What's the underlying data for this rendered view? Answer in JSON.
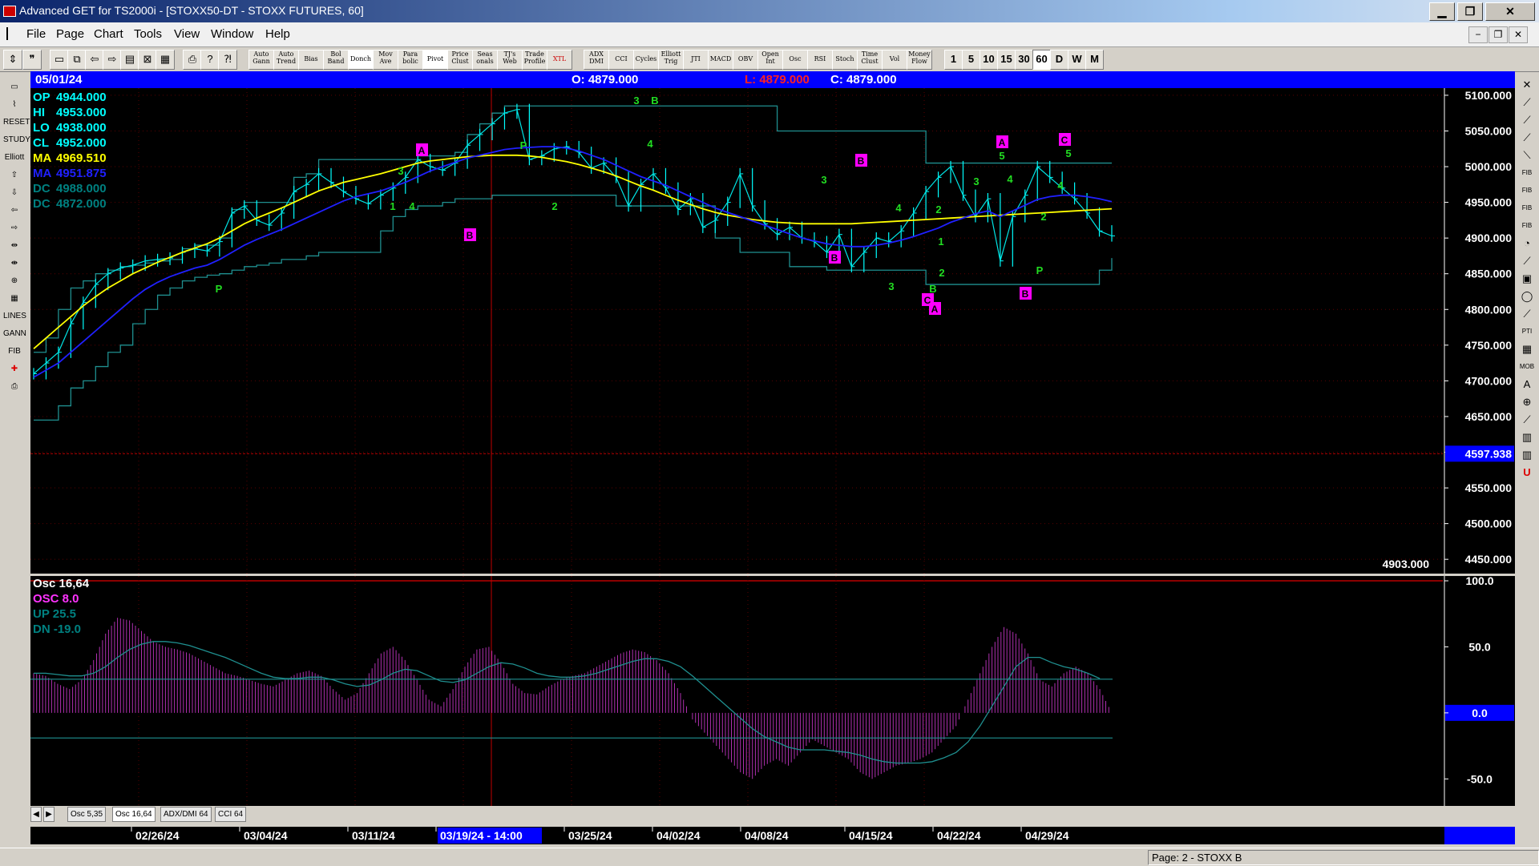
{
  "window": {
    "title": "Advanced GET for TS2000i - [STOXX50-DT - STOXX FUTURES, 60]",
    "minimize": "▁",
    "maximize": "❐",
    "close": "✕"
  },
  "menu": [
    "File",
    "Page",
    "Chart",
    "Tools",
    "View",
    "Window",
    "Help"
  ],
  "mdi_controls": [
    "−",
    "❐",
    "✕"
  ],
  "toolbar": {
    "studies": [
      "Auto Gann",
      "Auto Trend",
      "Bias",
      "Bol Band",
      "Donch",
      "Mov Ave",
      "Para bolic",
      "Pivot",
      "Price Clust",
      "Seas onals",
      "TJ's Web",
      "Trade Profile",
      "XTL",
      "ADX DMI",
      "CCI",
      "Cycles",
      "Elliott Trig",
      "JTI",
      "MACD",
      "OBV",
      "Open Int",
      "Osc",
      "RSI",
      "Stoch",
      "Time Clust",
      "Vol",
      "Money Flow"
    ],
    "periods": [
      "1",
      "5",
      "10",
      "15",
      "30",
      "60",
      "D",
      "W",
      "M"
    ],
    "active_period": "60"
  },
  "left_tools": [
    "open-icon",
    "gann-icon",
    "reset-icon",
    "study-icon",
    "elliott-icon",
    "arrow-up-icon",
    "arrow-down-icon",
    "arrow-left-icon",
    "arrow-right-icon",
    "expand-icon",
    "compress-icon",
    "zoom-icon",
    "grid-icon",
    "lines-icon",
    "gann-box-icon",
    "fib-icon",
    "cross-icon",
    "printer-icon"
  ],
  "left_tool_labels": [
    "",
    "",
    "RESET",
    "STUDY",
    "Elliott",
    "",
    "",
    "",
    "",
    "",
    "",
    "",
    "",
    "LINES",
    "GANN",
    "FIB",
    "",
    ""
  ],
  "right_tools": [
    "FIB",
    "FIB RET",
    "FIB EXT",
    "FIB TIME",
    "PTI",
    "MOB",
    "A"
  ],
  "infobar": {
    "date": "05/01/24",
    "open": "O: 4879.000",
    "low": "L: 4879.000",
    "close": "C: 4879.000"
  },
  "price_legend": [
    {
      "label": "OP",
      "value": "4944.000",
      "color": "#00ffff"
    },
    {
      "label": "HI",
      "value": "4953.000",
      "color": "#00ffff"
    },
    {
      "label": "LO",
      "value": "4938.000",
      "color": "#00ffff"
    },
    {
      "label": "CL",
      "value": "4952.000",
      "color": "#00ffff"
    },
    {
      "label": "MA",
      "value": "4969.510",
      "color": "#ffff00"
    },
    {
      "label": "MA",
      "value": "4951.875",
      "color": "#2020ff"
    },
    {
      "label": "DC",
      "value": "4988.000",
      "color": "#008080"
    },
    {
      "label": "DC",
      "value": "4872.000",
      "color": "#008080"
    }
  ],
  "price_axis": [
    "5100.000",
    "5050.000",
    "5000.000",
    "4950.000",
    "4900.000",
    "4850.000",
    "4800.000",
    "4750.000",
    "4700.000",
    "4650.000",
    "4600.000",
    "4550.000",
    "4500.000",
    "4450.000"
  ],
  "price_marker": "4597.938",
  "last_price": "4903.000",
  "osc_legend": [
    {
      "label": "Osc 16,64",
      "color": "#ffffff"
    },
    {
      "label": "OSC 8.0",
      "color": "#ff33ff"
    },
    {
      "label": "UP   25.5",
      "color": "#008080"
    },
    {
      "label": "DN   -19.0",
      "color": "#008080"
    }
  ],
  "osc_axis": [
    "100.0",
    "50.0",
    "0.0",
    "-50.0"
  ],
  "tabs": [
    "Osc 5,35",
    "Osc 16,64",
    "ADX/DMI 64",
    "CCI 64"
  ],
  "active_tab": "Osc 16,64",
  "date_axis": [
    "02/26/24",
    "03/04/24",
    "03/11/24",
    "03/19/24 - 14:00",
    "03/25/24",
    "04/02/24",
    "04/08/24",
    "04/15/24",
    "04/22/24",
    "04/29/24"
  ],
  "status": "Page: 2 - STOXX B",
  "elliott_labels": {
    "magenta_boxes": [
      "A",
      "B",
      "B",
      "B",
      "A",
      "C",
      "A",
      "C",
      "B"
    ],
    "green": [
      "3",
      "B",
      "4",
      "P",
      "3",
      "1",
      "4",
      "2",
      "3",
      "2",
      "4",
      "3",
      "1",
      "2",
      "3",
      "5",
      "4",
      "5",
      "4",
      "2",
      "P",
      "P",
      "B"
    ]
  },
  "chart_data": {
    "type": "line",
    "title": "",
    "ylim": [
      4430,
      5110
    ],
    "price_close": [
      4710,
      4725,
      4740,
      4780,
      4810,
      4835,
      4850,
      4858,
      4862,
      4868,
      4870,
      4872,
      4880,
      4885,
      4882,
      4895,
      4935,
      4945,
      4925,
      4918,
      4935,
      4965,
      4975,
      4990,
      4978,
      4965,
      4955,
      4948,
      4960,
      4970,
      4985,
      5010,
      5000,
      4995,
      5005,
      5030,
      5045,
      5060,
      5075,
      5080,
      5010,
      5015,
      5025,
      5028,
      5020,
      4998,
      5005,
      4985,
      4945,
      4975,
      4990,
      4970,
      4940,
      4955,
      4915,
      4925,
      4950,
      4990,
      4945,
      4920,
      4905,
      4915,
      4900,
      4895,
      4880,
      4905,
      4860,
      4880,
      4900,
      4895,
      4910,
      4935,
      4965,
      4985,
      5000,
      4960,
      4930,
      4955,
      4868,
      4930,
      4960,
      5000,
      4985,
      4970,
      4955,
      4935,
      4910,
      4903
    ],
    "ma_yellow": [
      4745,
      4760,
      4775,
      4790,
      4805,
      4818,
      4830,
      4840,
      4850,
      4858,
      4866,
      4873,
      4880,
      4886,
      4892,
      4900,
      4910,
      4920,
      4928,
      4935,
      4942,
      4950,
      4958,
      4966,
      4972,
      4978,
      4982,
      4986,
      4990,
      4995,
      5000,
      5005,
      5008,
      5010,
      5012,
      5014,
      5015,
      5016,
      5016,
      5016,
      5015,
      5013,
      5010,
      5007,
      5003,
      4998,
      4993,
      4987,
      4980,
      4973,
      4967,
      4960,
      4953,
      4947,
      4941,
      4936,
      4932,
      4929,
      4926,
      4924,
      4922,
      4921,
      4920,
      4920,
      4920,
      4920,
      4920,
      4921,
      4922,
      4923,
      4924,
      4925,
      4926,
      4927,
      4928,
      4929,
      4930,
      4931,
      4932,
      4933,
      4934,
      4935,
      4936,
      4937,
      4938,
      4939,
      4940,
      4941
    ],
    "ma_blue": [
      4705,
      4715,
      4725,
      4740,
      4755,
      4770,
      4785,
      4800,
      4815,
      4828,
      4838,
      4846,
      4852,
      4858,
      4862,
      4870,
      4880,
      4890,
      4898,
      4905,
      4912,
      4920,
      4928,
      4936,
      4944,
      4952,
      4958,
      4962,
      4966,
      4972,
      4978,
      4986,
      4994,
      5000,
      5006,
      5012,
      5016,
      5020,
      5024,
      5026,
      5027,
      5028,
      5028,
      5026,
      5022,
      5016,
      5010,
      5002,
      4994,
      4986,
      4980,
      4974,
      4966,
      4958,
      4950,
      4942,
      4936,
      4930,
      4924,
      4918,
      4912,
      4906,
      4900,
      4896,
      4892,
      4890,
      4888,
      4888,
      4890,
      4893,
      4897,
      4902,
      4908,
      4914,
      4922,
      4928,
      4934,
      4938,
      4930,
      4938,
      4946,
      4954,
      4958,
      4960,
      4960,
      4958,
      4955,
      4951
    ],
    "dc_upper": [
      4740,
      4760,
      4800,
      4830,
      4840,
      4850,
      4855,
      4860,
      4862,
      4865,
      4868,
      4870,
      4885,
      4890,
      4890,
      4900,
      4940,
      4950,
      4950,
      4950,
      4950,
      4985,
      4990,
      5010,
      5010,
      5010,
      5010,
      5010,
      5010,
      5010,
      5010,
      5015,
      5015,
      5015,
      5020,
      5045,
      5060,
      5075,
      5085,
      5085,
      5085,
      5085,
      5085,
      5085,
      5085,
      5085,
      5085,
      5085,
      5085,
      5085,
      5085,
      5085,
      5085,
      5085,
      5085,
      5085,
      5085,
      5085,
      5085,
      5085,
      5050,
      5050,
      5050,
      5050,
      5050,
      5050,
      5050,
      5050,
      5050,
      5050,
      5050,
      5050,
      5005,
      5005,
      5005,
      5005,
      5005,
      5005,
      5005,
      5005,
      5005,
      5005,
      5005,
      5005,
      5005,
      5005,
      5005,
      5005
    ],
    "dc_lower": [
      4645,
      4645,
      4665,
      4690,
      4700,
      4720,
      4740,
      4750,
      4780,
      4800,
      4820,
      4830,
      4840,
      4845,
      4848,
      4850,
      4855,
      4860,
      4862,
      4865,
      4870,
      4870,
      4875,
      4880,
      4880,
      4880,
      4880,
      4880,
      4910,
      4930,
      4940,
      4945,
      4945,
      4950,
      4955,
      4955,
      4955,
      4960,
      4960,
      4960,
      4960,
      4960,
      4960,
      4960,
      4960,
      4960,
      4960,
      4945,
      4945,
      4945,
      4945,
      4945,
      4945,
      4945,
      4945,
      4900,
      4900,
      4880,
      4880,
      4880,
      4880,
      4860,
      4860,
      4860,
      4855,
      4855,
      4855,
      4855,
      4855,
      4855,
      4855,
      4855,
      4835,
      4835,
      4835,
      4835,
      4835,
      4835,
      4835,
      4835,
      4835,
      4835,
      4835,
      4835,
      4835,
      4835,
      4855,
      4872
    ],
    "oscillator": {
      "name": "Osc 16,64",
      "ylim": [
        -65,
        100
      ],
      "values": [
        30,
        28,
        22,
        18,
        25,
        40,
        60,
        72,
        70,
        62,
        54,
        50,
        48,
        45,
        40,
        35,
        30,
        28,
        25,
        22,
        20,
        25,
        30,
        32,
        28,
        18,
        10,
        15,
        30,
        45,
        50,
        40,
        25,
        10,
        5,
        18,
        35,
        48,
        50,
        38,
        22,
        15,
        14,
        20,
        25,
        28,
        30,
        35,
        40,
        45,
        48,
        46,
        40,
        30,
        15,
        -5,
        -15,
        -25,
        -35,
        -45,
        -50,
        -40,
        -35,
        -40,
        -30,
        -20,
        -25,
        -30,
        -35,
        -45,
        -50,
        -45,
        -40,
        -38,
        -35,
        -30,
        -20,
        -10,
        10,
        30,
        50,
        65,
        60,
        45,
        25,
        20,
        30,
        35,
        30,
        18,
        0
      ],
      "signal": [
        30,
        30,
        29,
        28,
        28,
        30,
        35,
        42,
        48,
        52,
        54,
        54,
        53,
        51,
        48,
        45,
        42,
        38,
        34,
        30,
        27,
        26,
        26,
        27,
        27,
        25,
        22,
        20,
        21,
        25,
        30,
        33,
        32,
        28,
        24,
        23,
        25,
        30,
        35,
        38,
        37,
        34,
        30,
        28,
        27,
        27,
        28,
        30,
        33,
        36,
        39,
        41,
        41,
        39,
        35,
        28,
        20,
        12,
        4,
        -4,
        -12,
        -18,
        -22,
        -26,
        -28,
        -28,
        -28,
        -29,
        -30,
        -32,
        -35,
        -37,
        -38,
        -38,
        -38,
        -37,
        -34,
        -30,
        -22,
        -10,
        5,
        20,
        35,
        42,
        42,
        38,
        35,
        33,
        30,
        26
      ],
      "up": 25.5,
      "dn": -19.0
    }
  }
}
